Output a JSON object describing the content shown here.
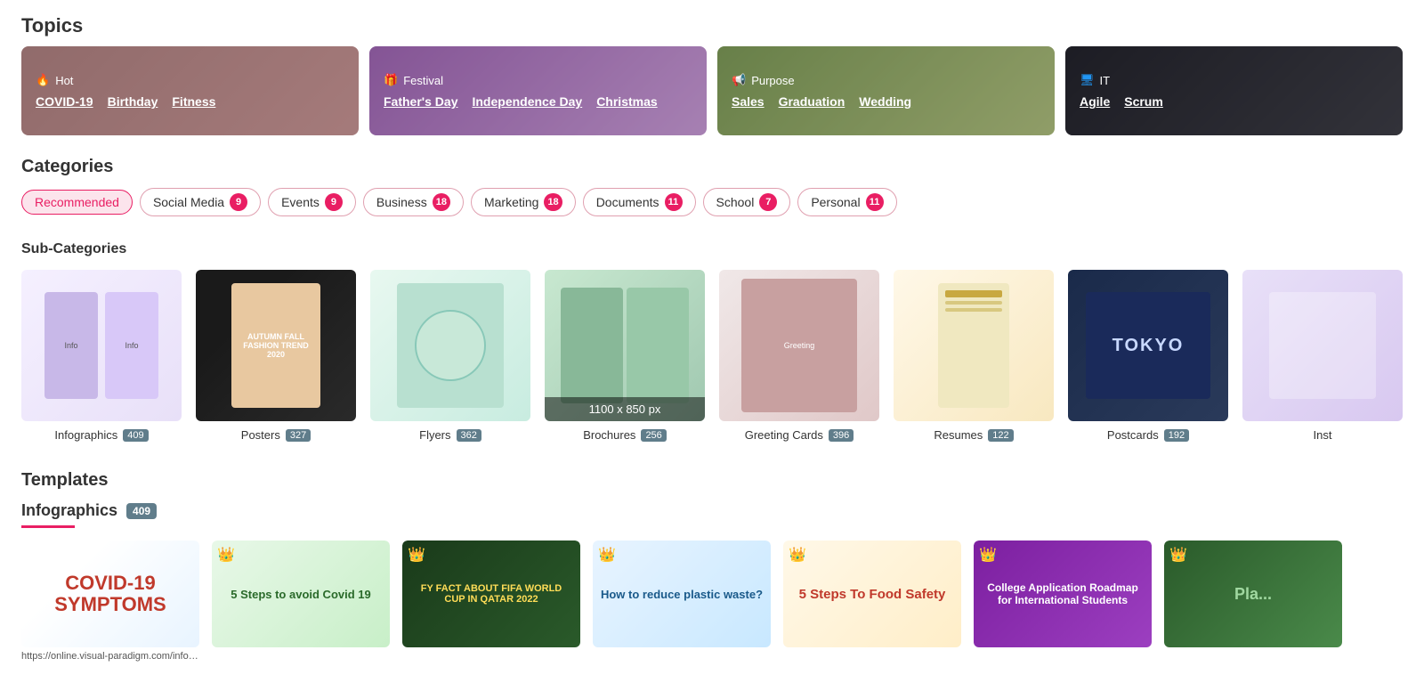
{
  "topics": {
    "title": "Topics",
    "cards": [
      {
        "id": "hot",
        "icon": "🔥",
        "icon_class": "icon-hot",
        "label": "Hot",
        "bg_class": "topic-bg-hot",
        "links": [
          "COVID-19",
          "Birthday",
          "Fitness"
        ]
      },
      {
        "id": "festival",
        "icon": "🎁",
        "icon_class": "icon-festival",
        "label": "Festival",
        "bg_class": "topic-bg-festival",
        "links": [
          "Father's Day",
          "Independence Day",
          "Christmas"
        ]
      },
      {
        "id": "purpose",
        "icon": "📢",
        "icon_class": "icon-purpose",
        "label": "Purpose",
        "bg_class": "topic-bg-purpose",
        "links": [
          "Sales",
          "Graduation",
          "Wedding"
        ]
      },
      {
        "id": "it",
        "icon": "🖥",
        "icon_class": "icon-it",
        "label": "IT",
        "bg_class": "topic-bg-it",
        "links": [
          "Agile",
          "Scrum"
        ]
      }
    ]
  },
  "categories": {
    "title": "Categories",
    "items": [
      {
        "label": "Recommended",
        "count": null,
        "active": true
      },
      {
        "label": "Social Media",
        "count": "9",
        "active": false
      },
      {
        "label": "Events",
        "count": "9",
        "active": false
      },
      {
        "label": "Business",
        "count": "18",
        "active": false
      },
      {
        "label": "Marketing",
        "count": "18",
        "active": false
      },
      {
        "label": "Documents",
        "count": "11",
        "active": false
      },
      {
        "label": "School",
        "count": "7",
        "active": false
      },
      {
        "label": "Personal",
        "count": "11",
        "active": false
      }
    ]
  },
  "subcategories": {
    "title": "Sub-Categories",
    "items": [
      {
        "label": "Infographics",
        "count": "409",
        "bg_class": "sc-infographics",
        "has_overlay": false
      },
      {
        "label": "Posters",
        "count": "327",
        "bg_class": "sc-posters",
        "has_overlay": false
      },
      {
        "label": "Flyers",
        "count": "362",
        "bg_class": "sc-flyers",
        "has_overlay": false
      },
      {
        "label": "Brochures",
        "count": "256",
        "bg_class": "sc-brochures",
        "has_overlay": true,
        "overlay_text": "1100 x 850 px"
      },
      {
        "label": "Greeting Cards",
        "count": "396",
        "bg_class": "sc-greeting",
        "has_overlay": false
      },
      {
        "label": "Resumes",
        "count": "122",
        "bg_class": "sc-resumes",
        "has_overlay": false
      },
      {
        "label": "Postcards",
        "count": "192",
        "bg_class": "sc-postcards",
        "has_overlay": false
      },
      {
        "label": "Inst",
        "count": "",
        "bg_class": "sc-inst",
        "has_overlay": false
      }
    ]
  },
  "templates": {
    "title": "Templates",
    "subtitle": "Infographics",
    "count": "409",
    "items": [
      {
        "id": "covid",
        "title": "COVID-19 SYMPTOMS",
        "bg_class": "tmpl-covid",
        "text_class": "template-text-covid",
        "has_crown": false,
        "url": "https://online.visual-paradigm.com/infoart/templates/brochures/"
      },
      {
        "id": "steps-covid",
        "title": "5 Steps to avoid Covid 19",
        "bg_class": "tmpl-steps",
        "text_class": "template-text-steps",
        "has_crown": true
      },
      {
        "id": "fifa",
        "title": "FY FACT ABOUT FIFA WORLD CUP IN QATAR 2022",
        "bg_class": "tmpl-fifa",
        "text_class": "template-text-fifa",
        "has_crown": true
      },
      {
        "id": "plastic",
        "title": "How to reduce plastic waste?",
        "bg_class": "tmpl-plastic",
        "text_class": "template-text-plastic",
        "has_crown": true
      },
      {
        "id": "food",
        "title": "5 Steps To Food Safety",
        "bg_class": "tmpl-food",
        "text_class": "template-text-food",
        "has_crown": true
      },
      {
        "id": "college",
        "title": "College Application Roadmap for International Students",
        "bg_class": "tmpl-college",
        "text_class": "template-text-college",
        "has_crown": true
      },
      {
        "id": "green",
        "title": "Pla...",
        "bg_class": "tmpl-green",
        "text_class": "template-text-green",
        "has_crown": true
      }
    ]
  }
}
